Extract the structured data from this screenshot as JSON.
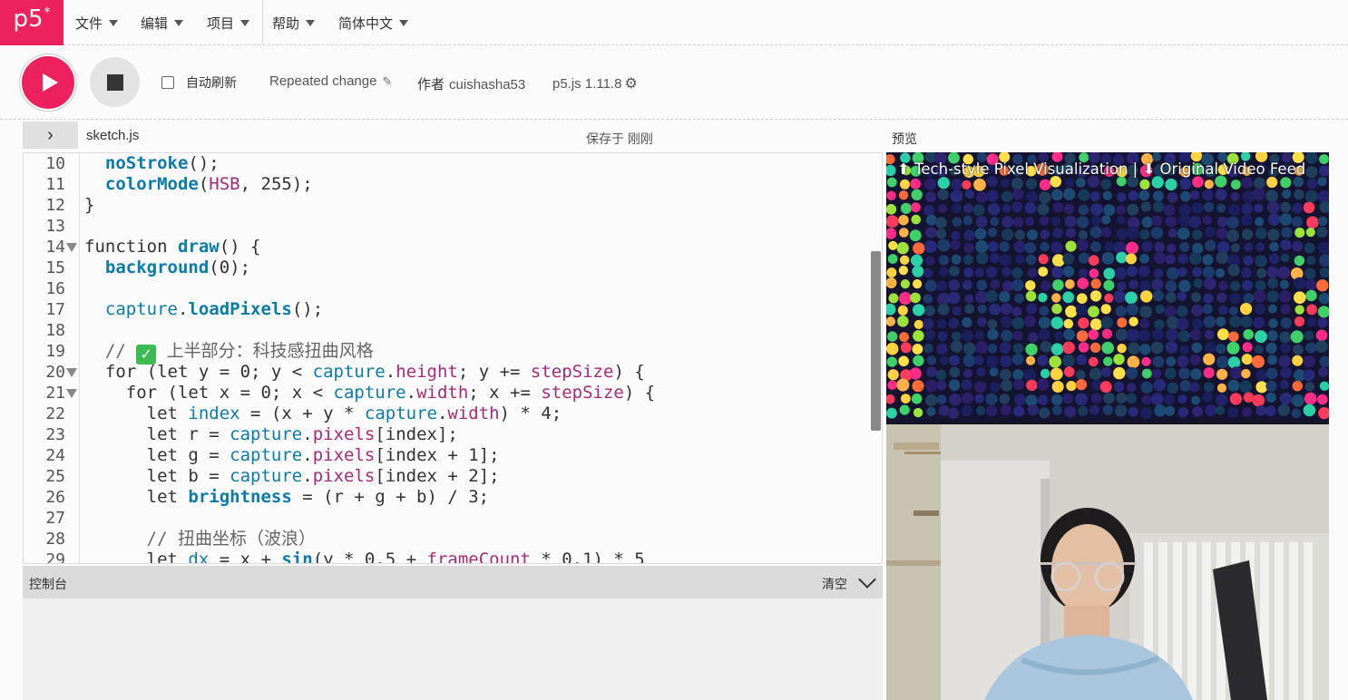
{
  "nav": {
    "logo": "p5",
    "logo_star": "*",
    "menus": [
      "文件",
      "编辑",
      "项目",
      "帮助",
      "简体中文"
    ]
  },
  "toolbar": {
    "auto_refresh_label": "自动刷新",
    "sketch_name": "Repeated change",
    "author_prefix": "作者",
    "author_name": "cuishasha53",
    "version": "p5.js 1.11.8"
  },
  "editor": {
    "file_name": "sketch.js",
    "saved_status": "保存于 刚刚",
    "preview_label": "预览"
  },
  "console": {
    "title": "控制台",
    "clear_label": "清空"
  },
  "preview": {
    "caption": "⬆ Tech-style Pixel Visualization | ⬇ Original Video Feed"
  },
  "colors": {
    "brand": "#ed225d"
  },
  "code_lines": [
    {
      "n": "10",
      "text": "  noStroke();"
    },
    {
      "n": "11",
      "text": "  colorMode(HSB, 255);"
    },
    {
      "n": "12",
      "text": "}"
    },
    {
      "n": "13",
      "text": ""
    },
    {
      "n": "14",
      "text": "function draw() {"
    },
    {
      "n": "15",
      "text": "  background(0);"
    },
    {
      "n": "16",
      "text": ""
    },
    {
      "n": "17",
      "text": "  capture.loadPixels();"
    },
    {
      "n": "18",
      "text": ""
    },
    {
      "n": "19",
      "text": "  // ✅ 上半部分：科技感扭曲风格"
    },
    {
      "n": "20",
      "text": "  for (let y = 0; y < capture.height; y += stepSize) {"
    },
    {
      "n": "21",
      "text": "    for (let x = 0; x < capture.width; x += stepSize) {"
    },
    {
      "n": "22",
      "text": "      let index = (x + y * capture.width) * 4;"
    },
    {
      "n": "23",
      "text": "      let r = capture.pixels[index];"
    },
    {
      "n": "24",
      "text": "      let g = capture.pixels[index + 1];"
    },
    {
      "n": "25",
      "text": "      let b = capture.pixels[index + 2];"
    },
    {
      "n": "26",
      "text": "      let brightness = (r + g + b) / 3;"
    },
    {
      "n": "27",
      "text": ""
    },
    {
      "n": "28",
      "text": "      // 扭曲坐标（波浪）"
    },
    {
      "n": "29",
      "text": "      let dx = x + sin(y * 0.5 + frameCount * 0.1) * 5"
    }
  ]
}
